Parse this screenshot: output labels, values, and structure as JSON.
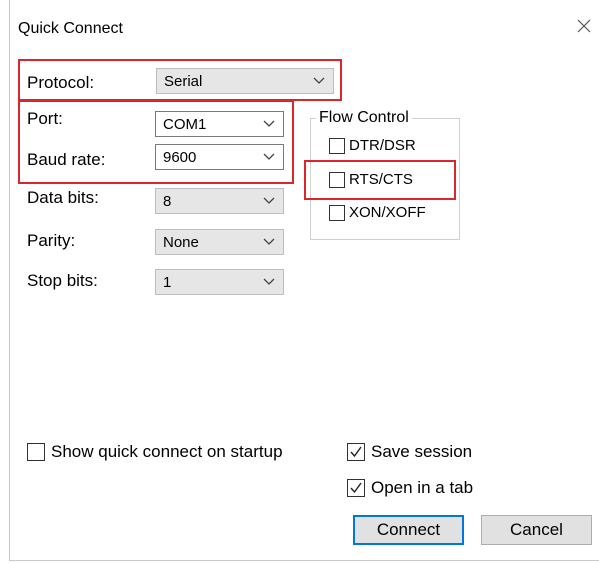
{
  "window": {
    "title": "Quick Connect"
  },
  "icons": {
    "close": "close-icon",
    "dropdown": "chevron-down-icon",
    "check": "checkmark-icon"
  },
  "colors": {
    "highlight": "#d9252b",
    "default_button_border": "#0078d7"
  },
  "fields": {
    "protocol": {
      "label": "Protocol:",
      "value": "Serial"
    },
    "port": {
      "label": "Port:",
      "value": "COM1"
    },
    "baud_rate": {
      "label": "Baud rate:",
      "value": "9600"
    },
    "data_bits": {
      "label": "Data bits:",
      "value": "8"
    },
    "parity": {
      "label": "Parity:",
      "value": "None"
    },
    "stop_bits": {
      "label": "Stop bits:",
      "value": "1"
    }
  },
  "flow_control": {
    "title": "Flow Control",
    "options": [
      {
        "label": "DTR/DSR",
        "checked": false
      },
      {
        "label": "RTS/CTS",
        "checked": false
      },
      {
        "label": "XON/XOFF",
        "checked": false
      }
    ]
  },
  "options": {
    "show_on_startup": {
      "label": "Show quick connect on startup",
      "checked": false
    },
    "save_session": {
      "label": "Save session",
      "checked": true
    },
    "open_in_tab": {
      "label": "Open in a tab",
      "checked": true
    }
  },
  "buttons": {
    "connect": "Connect",
    "cancel": "Cancel"
  }
}
